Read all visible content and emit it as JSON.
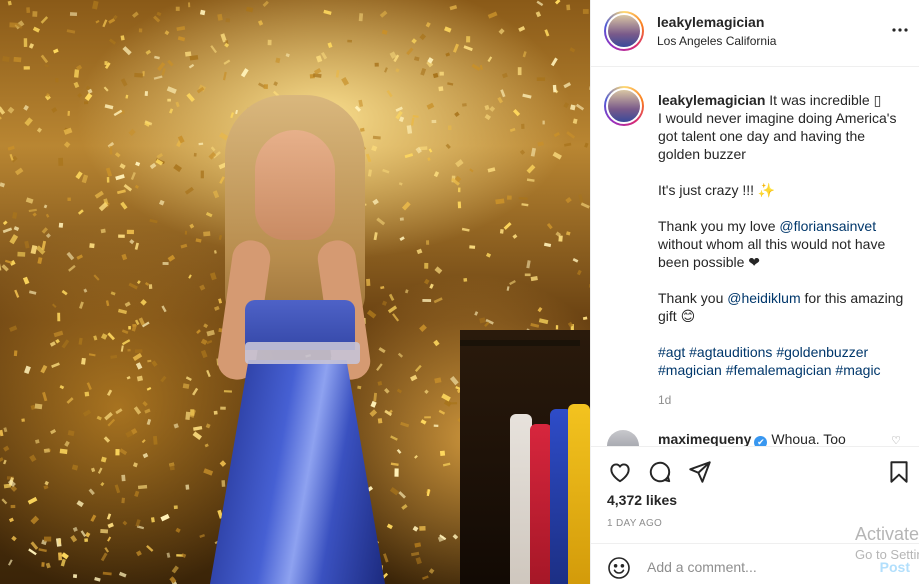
{
  "post": {
    "media_alt": "performer-on-stage-with-golden-confetti"
  },
  "header": {
    "username": "leakylemagician",
    "location": "Los Angeles California",
    "more_icon": "more-horizontal-icon"
  },
  "caption": {
    "username": "leakylemagician",
    "text_1": " It was incredible ",
    "glyph_1": "▯",
    "text_2": "\nI would never imagine doing America's got talent one day and having the golden buzzer\n\nIt's just crazy !!! ",
    "emoji_sparkles": "✨",
    "text_3": "\n\nThank you my love ",
    "mention_1": "@floriansainvet",
    "text_4": "\nwithout whom all this would not have been possible ",
    "emoji_heart": "❤",
    "text_5": "\n\nThank you ",
    "mention_2": "@heidiklum",
    "text_6": " for this amazing gift ",
    "emoji_smile": "😊",
    "text_7": "\n\n",
    "hashtags_line1": "#agt #agtauditions #goldenbuzzer",
    "hashtags_line2": "#magician #femalemagician #magic",
    "age": "1d"
  },
  "comment": {
    "username": "maximequeny",
    "verified": "✔",
    "text": "Whoua. Too",
    "heart": "♡"
  },
  "actions": {
    "like_icon": "heart-icon",
    "comment_icon": "comment-icon",
    "share_icon": "paper-plane-icon",
    "save_icon": "bookmark-icon",
    "likes": "4,372 likes",
    "posted": "1 DAY AGO"
  },
  "compose": {
    "emoji_icon": "smiley-icon",
    "placeholder": "Add a comment...",
    "post_label": "Post"
  },
  "watermark": {
    "title": "Activate Windows",
    "subtitle": "Go to Settings to activate Windows."
  },
  "colors": {
    "link": "#00376b",
    "post_disabled": "#b2dffc",
    "border": "#efefef",
    "muted": "#8e8e8e"
  }
}
